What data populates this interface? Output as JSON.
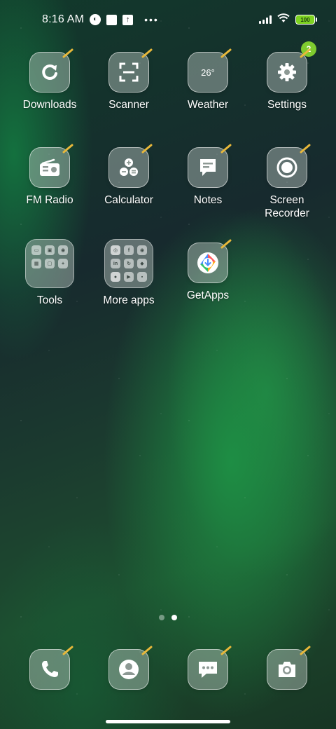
{
  "status_bar": {
    "time": "8:16 AM",
    "battery": "100",
    "icons": [
      "signal-icon",
      "wifi-icon",
      "battery-icon"
    ]
  },
  "apps": [
    {
      "label": "Downloads",
      "icon": "refresh-icon"
    },
    {
      "label": "Scanner",
      "icon": "scan-icon"
    },
    {
      "label": "Weather",
      "icon": "weather-icon",
      "temp": "26°"
    },
    {
      "label": "Settings",
      "icon": "gear-icon",
      "badge": "2"
    },
    {
      "label": "FM Radio",
      "icon": "radio-icon"
    },
    {
      "label": "Calculator",
      "icon": "calculator-icon"
    },
    {
      "label": "Notes",
      "icon": "notes-icon"
    },
    {
      "label": "Screen\nRecorder",
      "icon": "record-icon"
    },
    {
      "label": "Tools",
      "icon": "folder-icon"
    },
    {
      "label": "More apps",
      "icon": "folder-icon"
    },
    {
      "label": "GetApps",
      "icon": "getapps-icon"
    }
  ],
  "dock": [
    {
      "name": "phone",
      "icon": "phone-icon"
    },
    {
      "name": "contacts",
      "icon": "contacts-icon"
    },
    {
      "name": "messages",
      "icon": "messages-icon"
    },
    {
      "name": "camera",
      "icon": "camera-icon"
    }
  ],
  "page_indicator": {
    "count": 2,
    "active": 2
  },
  "colors": {
    "badge": "#7fcb2f",
    "battery": "#7ed321"
  }
}
